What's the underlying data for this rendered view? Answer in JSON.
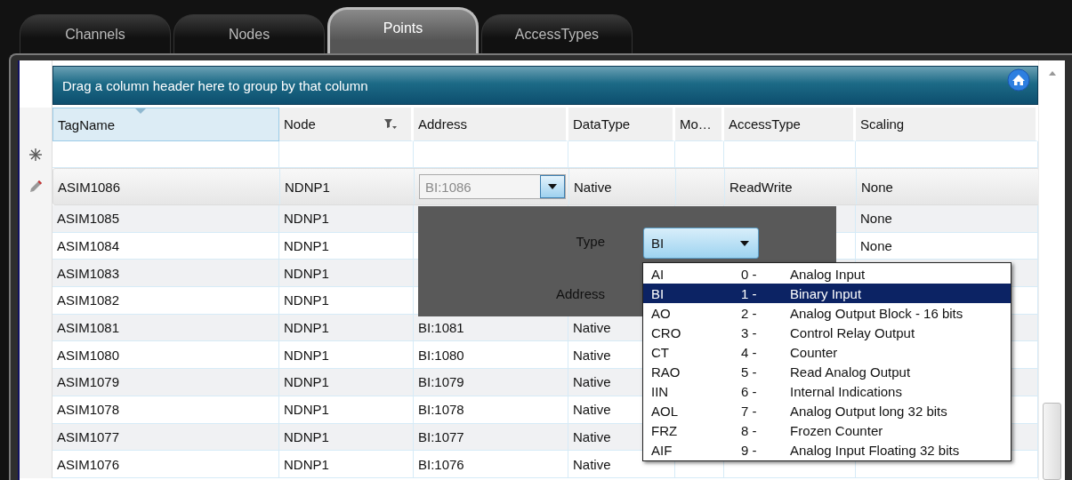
{
  "tabs": [
    {
      "label": "Channels",
      "selected": false
    },
    {
      "label": "Nodes",
      "selected": false
    },
    {
      "label": "Points",
      "selected": true
    },
    {
      "label": "AccessTypes",
      "selected": false
    }
  ],
  "grid": {
    "group_panel_text": "Drag a column header here to group by that column",
    "columns": [
      {
        "label": "TagName",
        "sorted": true,
        "filter": false
      },
      {
        "label": "Node",
        "sorted": false,
        "filter": true
      },
      {
        "label": "Address",
        "sorted": false,
        "filter": false
      },
      {
        "label": "DataType",
        "sorted": false,
        "filter": false
      },
      {
        "label": "Mo…",
        "sorted": false,
        "filter": false
      },
      {
        "label": "AccessType",
        "sorted": false,
        "filter": false
      },
      {
        "label": "Scaling",
        "sorted": false,
        "filter": false
      }
    ],
    "editing_row": {
      "tag_name": "ASIM1086",
      "node": "NDNP1",
      "address": "BI:1086",
      "data_type": "Native",
      "access_type": "ReadWrite",
      "scaling": "None"
    },
    "rows": [
      {
        "tag_name": "ASIM1085",
        "node": "NDNP1",
        "scaling": "None"
      },
      {
        "tag_name": "ASIM1084",
        "node": "NDNP1",
        "scaling": "None"
      },
      {
        "tag_name": "ASIM1083",
        "node": "NDNP1"
      },
      {
        "tag_name": "ASIM1082",
        "node": "NDNP1"
      },
      {
        "tag_name": "ASIM1081",
        "node": "NDNP1",
        "address": "BI:1081",
        "data_type": "Native"
      },
      {
        "tag_name": "ASIM1080",
        "node": "NDNP1",
        "address": "BI:1080",
        "data_type": "Native"
      },
      {
        "tag_name": "ASIM1079",
        "node": "NDNP1",
        "address": "BI:1079",
        "data_type": "Native"
      },
      {
        "tag_name": "ASIM1078",
        "node": "NDNP1",
        "address": "BI:1078",
        "data_type": "Native"
      },
      {
        "tag_name": "ASIM1077",
        "node": "NDNP1",
        "address": "BI:1077",
        "data_type": "Native"
      },
      {
        "tag_name": "ASIM1076",
        "node": "NDNP1",
        "address": "BI:1076",
        "data_type": "Native"
      }
    ]
  },
  "address_editor": {
    "type_label": "Type",
    "type_value": "BI",
    "address_label": "Address",
    "options": [
      {
        "code": "AI",
        "number": "0 -",
        "description": "Analog Input",
        "selected": false
      },
      {
        "code": "BI",
        "number": "1 -",
        "description": "Binary Input",
        "selected": true
      },
      {
        "code": "AO",
        "number": "2 -",
        "description": "Analog Output Block - 16 bits",
        "selected": false
      },
      {
        "code": "CRO",
        "number": "3 -",
        "description": "Control Relay Output",
        "selected": false
      },
      {
        "code": "CT",
        "number": "4 -",
        "description": "Counter",
        "selected": false
      },
      {
        "code": "RAO",
        "number": "5 -",
        "description": "Read Analog Output",
        "selected": false
      },
      {
        "code": "IIN",
        "number": "6 -",
        "description": "Internal Indications",
        "selected": false
      },
      {
        "code": "AOL",
        "number": "7 -",
        "description": "Analog Output long 32 bits",
        "selected": false
      },
      {
        "code": "FRZ",
        "number": "8 -",
        "description": "Frozen Counter",
        "selected": false
      },
      {
        "code": "AIF",
        "number": "9 -",
        "description": "Analog Input Floating 32 bits",
        "selected": false
      }
    ]
  }
}
